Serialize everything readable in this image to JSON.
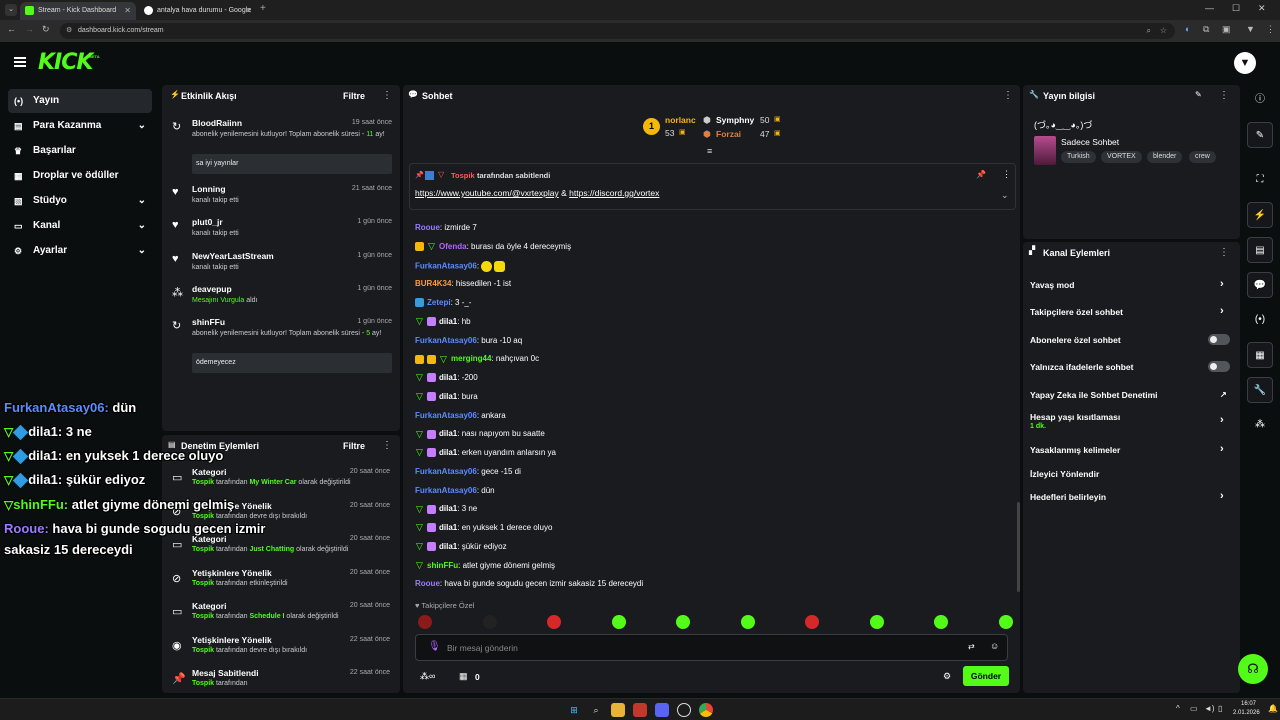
{
  "browser": {
    "tabs": [
      {
        "title": "Stream - Kick Dashboard"
      },
      {
        "title": "antalya hava durumu - Google"
      }
    ],
    "url": "dashboard.kick.com/stream"
  },
  "header": {
    "logo": "KICK",
    "beta": "BETA"
  },
  "sidebar": {
    "items": [
      {
        "label": "Yayın",
        "icon": "broadcast-icon"
      },
      {
        "label": "Para Kazanma",
        "icon": "wallet-icon"
      },
      {
        "label": "Başarılar",
        "icon": "trophy-icon"
      },
      {
        "label": "Droplar ve ödüller",
        "icon": "gift-icon"
      },
      {
        "label": "Stüdyo",
        "icon": "layout-icon"
      },
      {
        "label": "Kanal",
        "icon": "channel-icon"
      },
      {
        "label": "Ayarlar",
        "icon": "gear-icon"
      }
    ]
  },
  "activity": {
    "title": "Etkinlik Akışı",
    "filter": "Filtre",
    "events": [
      {
        "name": "BloodRaiinn",
        "time": "19 saat önce",
        "desc_a": "abonelik yenilemesini kutluyor! Toplam abonelik süresi - ",
        "desc_num": "11",
        "desc_b": " ay!",
        "message": "sa iyi yayınlar"
      },
      {
        "name": "Lonning",
        "time": "21 saat önce",
        "desc": "kanalı takip etti"
      },
      {
        "name": "plut0_jr",
        "time": "1 gün önce",
        "desc": "kanalı takip etti"
      },
      {
        "name": "NewYearLastStream",
        "time": "1 gün önce",
        "desc": "kanalı takip etti"
      },
      {
        "name": "deavepup",
        "time": "1 gün önce",
        "desc_hl": "Mesajını Vurgula",
        "desc_b": " aldı"
      },
      {
        "name": "shinFFu",
        "time": "1 gün önce",
        "desc_a": "abonelik yenilemesini kutluyor! Toplam abonelik süresi - ",
        "desc_num": "5",
        "desc_b": " ay!",
        "message": "ödemeyecez"
      }
    ]
  },
  "moderation": {
    "title": "Denetim Eylemleri",
    "filter": "Filtre",
    "events": [
      {
        "name": "Kategori",
        "time": "20 saat önce",
        "user": "Tospik",
        "a": " tarafından ",
        "hl": "My Winter Car",
        "b": " olarak değiştirildi"
      },
      {
        "name": "Yetişkinlere Yönelik",
        "time": "20 saat önce",
        "user": "Tospik",
        "a": " tarafından devre dışı bırakıldı",
        "hl": "",
        "b": ""
      },
      {
        "name": "Kategori",
        "time": "20 saat önce",
        "user": "Tospik",
        "a": " tarafından ",
        "hl": "Just Chatting",
        "b": " olarak değiştirildi"
      },
      {
        "name": "Yetişkinlere Yönelik",
        "time": "20 saat önce",
        "user": "Tospik",
        "a": " tarafından etkinleştirildi",
        "hl": "",
        "b": ""
      },
      {
        "name": "Kategori",
        "time": "20 saat önce",
        "user": "Tospik",
        "a": " tarafından ",
        "hl": "Schedule I",
        "b": " olarak değiştirildi"
      },
      {
        "name": "Yetişkinlere Yönelik",
        "time": "22 saat önce",
        "user": "Tospik",
        "a": " tarafından devre dışı bırakıldı",
        "hl": "",
        "b": ""
      },
      {
        "name": "Mesaj Sabitlendi",
        "time": "22 saat önce",
        "user": "Tospik",
        "a": " tarafından",
        "hl": "",
        "b": ""
      }
    ]
  },
  "chat": {
    "title": "Sohbet",
    "leaders": [
      {
        "name": "norlanc",
        "value": "53"
      },
      {
        "name": "Symphny",
        "value": "50"
      },
      {
        "name": "Forzai",
        "value": "47"
      }
    ],
    "pinned": {
      "by": "Tospik",
      "label": "tarafından sabitlendi",
      "link1": "https://www.youtube.com/@vxrtexplay",
      "sep": " & ",
      "link2": "https://discord.gg/vortex"
    },
    "messages": [
      {
        "user": "Rooue",
        "color": "#9b7cff",
        "text": "izmirde 7"
      },
      {
        "user": "Ofenda",
        "color": "#b565ff",
        "text": "burası da öyle 4 dereceymiş"
      },
      {
        "user": "FurkanAtasay06",
        "color": "#5b8cff",
        "text": ""
      },
      {
        "user": "BUR4K34",
        "color": "#ff9a3c",
        "text": "hissedilen -1 ist"
      },
      {
        "user": "Zetepi",
        "color": "#5b8cff",
        "text": "3 -_-"
      },
      {
        "user": "dila1",
        "color": "#ffffff",
        "text": "hb"
      },
      {
        "user": "FurkanAtasay06",
        "color": "#5b8cff",
        "text": "bura -10 aq"
      },
      {
        "user": "merging44",
        "color": "#53fc18",
        "text": "nahçıvan 0c"
      },
      {
        "user": "dila1",
        "color": "#ffffff",
        "text": "-200"
      },
      {
        "user": "dila1",
        "color": "#ffffff",
        "text": "bura"
      },
      {
        "user": "FurkanAtasay06",
        "color": "#5b8cff",
        "text": "ankara"
      },
      {
        "user": "dila1",
        "color": "#ffffff",
        "text": "nası napıyom bu saatte"
      },
      {
        "user": "dila1",
        "color": "#ffffff",
        "text": "erken uyandım anlarsın ya"
      },
      {
        "user": "FurkanAtasay06",
        "color": "#5b8cff",
        "text": "gece -15 di"
      },
      {
        "user": "FurkanAtasay06",
        "color": "#5b8cff",
        "text": "dün"
      },
      {
        "user": "dila1",
        "color": "#ffffff",
        "text": "3 ne"
      },
      {
        "user": "dila1",
        "color": "#ffffff",
        "text": "en yuksek 1 derece oluyo"
      },
      {
        "user": "dila1",
        "color": "#ffffff",
        "text": "şükür ediyoz"
      },
      {
        "user": "shinFFu",
        "color": "#53fc18",
        "text": "atlet giyme dönemi gelmiş"
      },
      {
        "user": "Rooue",
        "color": "#9b7cff",
        "text": "hava bi gunde sogudu gecen izmir sakasiz 15 dereceydi"
      }
    ],
    "followers_only": "Takipçilere Özel",
    "input_placeholder": "Bir mesaj gönderin",
    "send": "Gönder",
    "points": "0"
  },
  "stream_info": {
    "title": "Yayın bilgisi",
    "stream_title": "(づ｡◕‿‿◕｡)づ",
    "category": "Sadece Sohbet",
    "tags": [
      "Turkish",
      "VORTEX",
      "blender",
      "crew"
    ]
  },
  "channel_actions": {
    "title": "Kanal Eylemleri",
    "items": [
      {
        "label": "Yavaş mod"
      },
      {
        "label": "Takipçilere özel sohbet"
      },
      {
        "label": "Abonelere özel sohbet"
      },
      {
        "label": "Yalnızca ifadelerle sohbet"
      },
      {
        "label": "Yapay Zeka ile Sohbet Denetimi"
      },
      {
        "label": "Hesap yaşı kısıtlaması",
        "sub": "1 dk."
      },
      {
        "label": "Yasaklanmış kelimeler"
      },
      {
        "label": "İzleyici Yönlendir"
      },
      {
        "label": "Hedefleri belirleyin"
      }
    ]
  },
  "overlay": [
    {
      "user": "FurkanAtasay06:",
      "text": " dün",
      "color": "#5b8cff"
    },
    {
      "user": "dila1:",
      "text": " 3 ne",
      "color": "#ffffff"
    },
    {
      "user": "dila1:",
      "text": " en yuksek 1 derece oluyo",
      "color": "#ffffff"
    },
    {
      "user": "dila1:",
      "text": " şükür ediyoz",
      "color": "#ffffff"
    },
    {
      "user": "shinFFu:",
      "text": " atlet giyme dönemi gelmiş",
      "color": "#53fc18"
    },
    {
      "user": "Rooue:",
      "text": " hava bi gunde sogudu gecen izmir",
      "color": "#9b7cff"
    },
    {
      "user": "",
      "text": "sakasiz 15 dereceydi",
      "color": "#ffffff"
    }
  ],
  "taskbar": {
    "time": "16:07",
    "date": "2.01.2026"
  }
}
